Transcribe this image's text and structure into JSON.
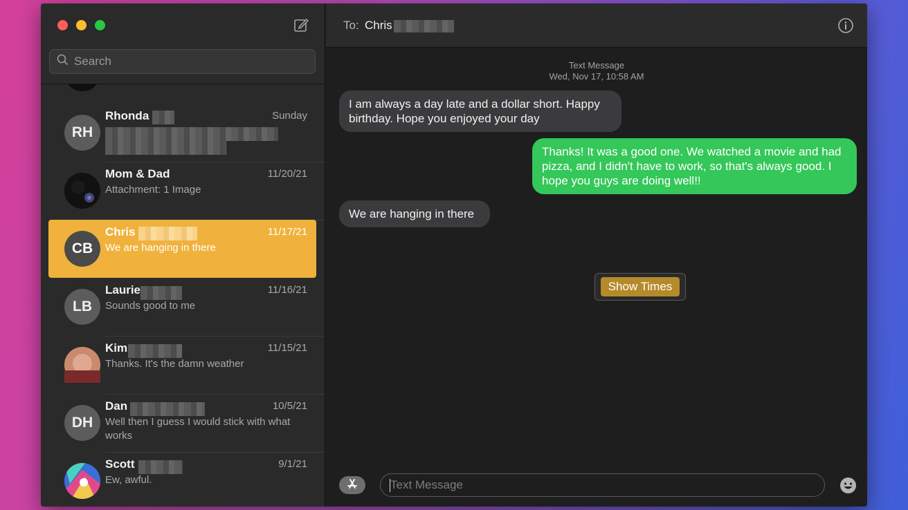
{
  "sidebar": {
    "search_placeholder": "Search",
    "conversations": [
      {
        "initials": "RH",
        "name": "Rhonda",
        "date": "Sunday",
        "preview": ""
      },
      {
        "initials": "",
        "name": "Mom & Dad",
        "date": "11/20/21",
        "preview": "Attachment: 1 Image"
      },
      {
        "initials": "CB",
        "name": "Chris",
        "date": "11/17/21",
        "preview": "We are hanging in there"
      },
      {
        "initials": "LB",
        "name": "Laurie",
        "date": "11/16/21",
        "preview": "Sounds good to me"
      },
      {
        "initials": "",
        "name": "Kim",
        "date": "11/15/21",
        "preview": "Thanks.  It's the damn weather"
      },
      {
        "initials": "DH",
        "name": "Dan",
        "date": "10/5/21",
        "preview": "Well then I guess I would stick with what works"
      },
      {
        "initials": "",
        "name": "Scott",
        "date": "9/1/21",
        "preview": "Ew, awful."
      }
    ]
  },
  "header": {
    "to_label": "To:",
    "recipient": "Chris"
  },
  "thread": {
    "service": "Text Message",
    "timestamp": "Wed, Nov 17, 10:58 AM",
    "messages": [
      {
        "direction": "in",
        "text": "I am always a day late and a dollar short.   Happy birthday.  Hope you enjoyed your day"
      },
      {
        "direction": "out",
        "text": "Thanks! It was a good one. We watched a movie and had pizza, and I didn't have to work, so that's always good. I hope you guys are doing well!!"
      },
      {
        "direction": "in",
        "text": "We are hanging in there"
      }
    ],
    "show_times_label": "Show Times"
  },
  "composer": {
    "placeholder": "Text Message"
  },
  "colors": {
    "selected": "#f0b23c",
    "outgoing_bubble": "#34c759",
    "incoming_bubble": "#3b3b3d"
  }
}
